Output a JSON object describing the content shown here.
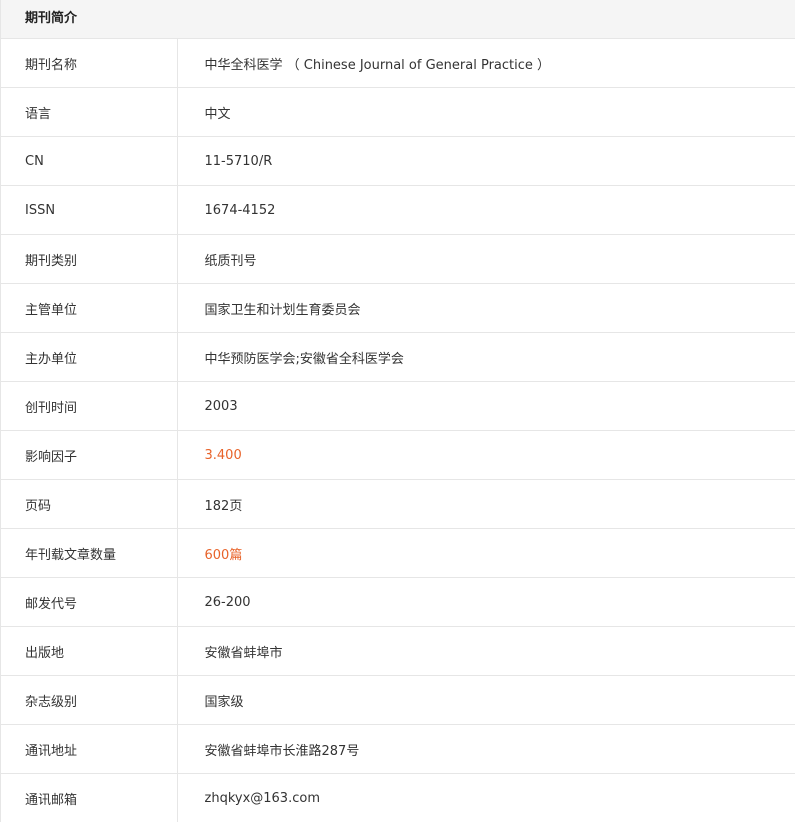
{
  "header": {
    "title": "期刊简介"
  },
  "colors": {
    "accent": "#e8632a",
    "text": "#333333",
    "border": "#e6e6e6",
    "header_bg": "#f5f5f5"
  },
  "rows": [
    {
      "label": "期刊名称",
      "value": "中华全科医学 （ Chinese Journal of General Practice ）"
    },
    {
      "label": "语言",
      "value": "中文"
    },
    {
      "label": "CN",
      "value": "11-5710/R"
    },
    {
      "label": "ISSN",
      "value": "1674-4152"
    },
    {
      "label": "期刊类别",
      "value": "纸质刊号"
    },
    {
      "label": "主管单位",
      "value": "国家卫生和计划生育委员会"
    },
    {
      "label": "主办单位",
      "value": "中华预防医学会;安徽省全科医学会"
    },
    {
      "label": "创刊时间",
      "value": "2003"
    },
    {
      "label": "影响因子",
      "value": "3.400"
    },
    {
      "label": "页码",
      "value": "182页"
    },
    {
      "label": "年刊载文章数量",
      "value": "600篇"
    },
    {
      "label": "邮发代号",
      "value": "26-200"
    },
    {
      "label": "出版地",
      "value": "安徽省蚌埠市"
    },
    {
      "label": "杂志级别",
      "value": "国家级"
    },
    {
      "label": "通讯地址",
      "value": "安徽省蚌埠市长淮路287号"
    },
    {
      "label": "通讯邮箱",
      "value": "zhqkyx@163.com"
    }
  ]
}
